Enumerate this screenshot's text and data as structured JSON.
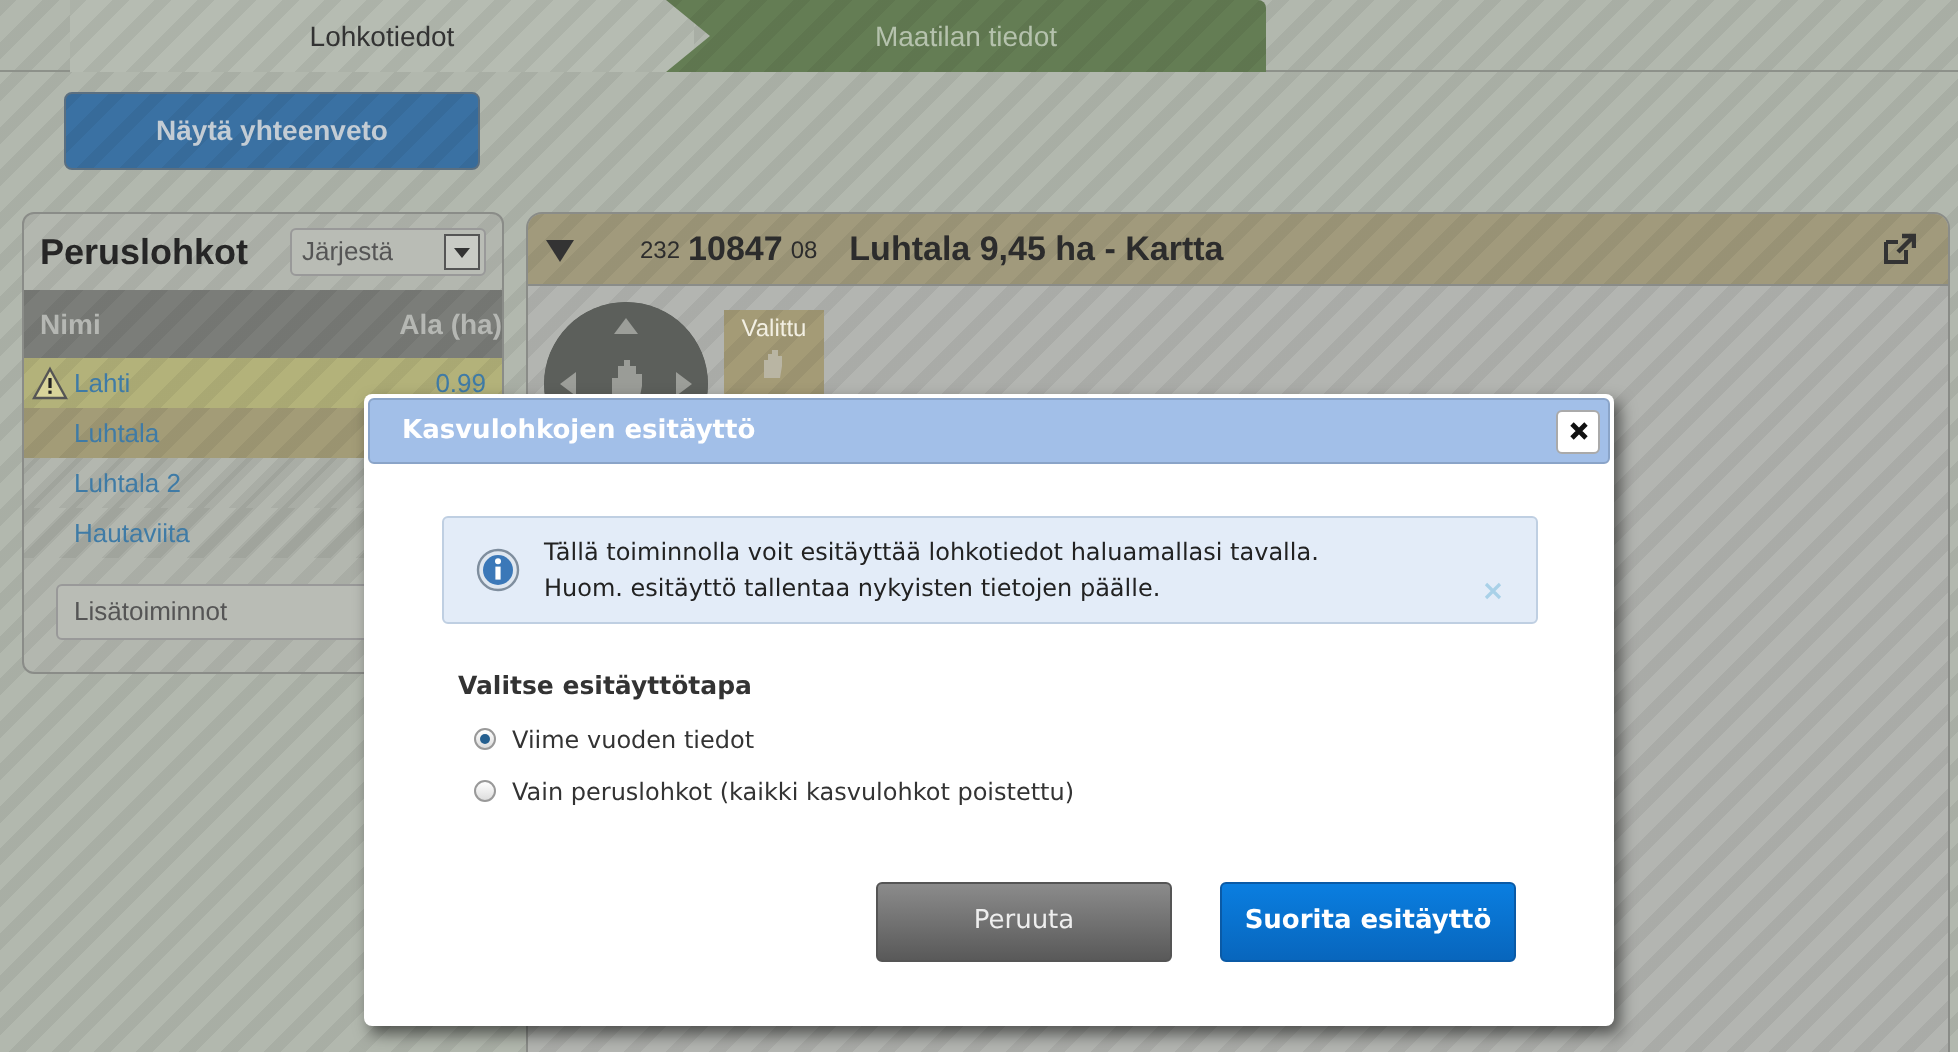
{
  "tabs": [
    {
      "label": "Lohkotiedot",
      "selected": true
    },
    {
      "label": "Maatilan tiedot",
      "selected": false
    }
  ],
  "summary_button": "Näytä yhteenveto",
  "parcel_panel": {
    "title": "Peruslohkot",
    "sort_select": "Järjestä",
    "columns": [
      "Nimi",
      "Ala (ha)"
    ],
    "rows": [
      {
        "name": "Lahti",
        "area": "0.99",
        "warning": true,
        "selected": false
      },
      {
        "name": "Luhtala",
        "warning": false,
        "selected": true
      },
      {
        "name": "Luhtala 2",
        "warning": false,
        "selected": false
      },
      {
        "name": "Hautaviita",
        "warning": false,
        "selected": false
      }
    ],
    "actions_select": "Lisätoiminnot"
  },
  "map_panel": {
    "code_prefix": "232",
    "code_main": "10847",
    "code_suffix": "08",
    "title": "Luhtala 9,45 ha - Kartta",
    "tool_label": "Valittu"
  },
  "dialog": {
    "title": "Kasvulohkojen esitäyttö",
    "info_lines": [
      "Tällä toiminnolla voit esitäyttää lohkotiedot haluamallasi tavalla.",
      "Huom. esitäyttö tallentaa nykyisten tietojen päälle."
    ],
    "options_label": "Valitse esitäyttötapa",
    "options": [
      {
        "label": "Viime vuoden tiedot",
        "selected": true
      },
      {
        "label": "Vain peruslohkot (kaikki kasvulohkot poistettu)",
        "selected": false
      }
    ],
    "buttons": [
      {
        "label": "Peruuta",
        "kind": "secondary"
      },
      {
        "label": "Suorita esitäyttö",
        "kind": "primary"
      }
    ]
  }
}
